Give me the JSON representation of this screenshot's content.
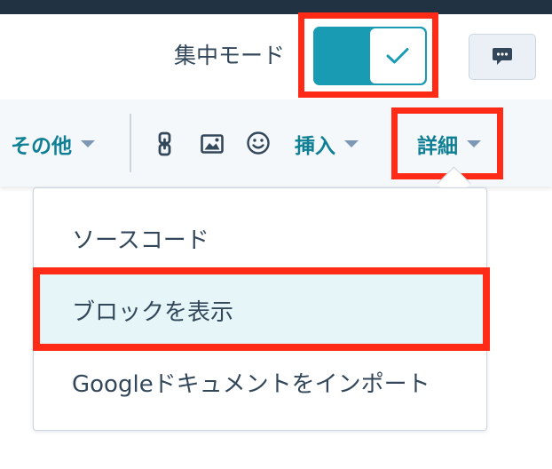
{
  "header": {
    "focus_mode_label": "集中モード",
    "focus_mode_on": true,
    "chat_icon": "chat-bubble-icon"
  },
  "toolbar": {
    "more_label": "その他",
    "link_icon": "link-icon",
    "image_icon": "image-icon",
    "emoji_icon": "emoji-icon",
    "insert_label": "挿入",
    "advanced_label": "詳細"
  },
  "dropdown": {
    "items": [
      {
        "label": "ソースコード"
      },
      {
        "label": "ブロックを表示",
        "selected": true
      },
      {
        "label": "Googleドキュメントをインポート"
      }
    ]
  },
  "colors": {
    "accent": "#1a9bb4",
    "link_text": "#0f7f95",
    "highlight": "#ff2b16",
    "selected_bg": "#e5f5f8",
    "dark_bar": "#213343"
  }
}
